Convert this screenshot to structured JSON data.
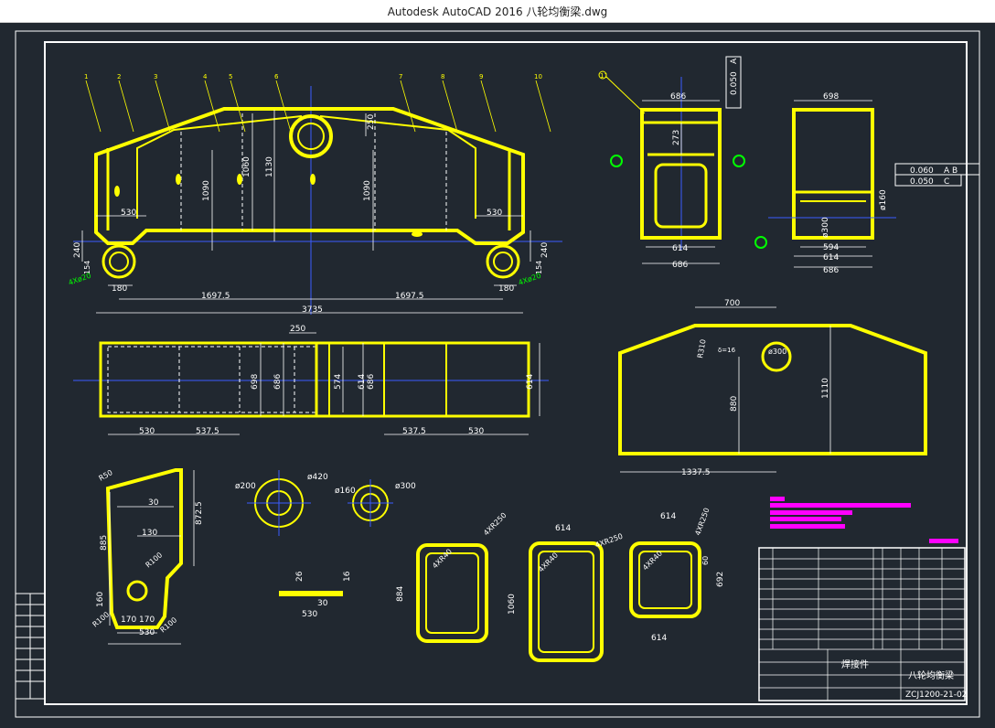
{
  "window": {
    "title": "Autodesk AutoCAD 2016    八轮均衡梁.dwg"
  },
  "colors": {
    "background": "#212830",
    "outline": "#ffff00",
    "dimension": "#ffffff",
    "center": "#3a5bff",
    "leader": "#00ff00",
    "magenta": "#ff00ff"
  },
  "front_view": {
    "dims": {
      "d530_left": "530",
      "d530_right": "530",
      "d1090_a": "1090",
      "d1090_b": "1090",
      "d1060": "1060",
      "d1130": "1130",
      "d250": "250",
      "d240_left": "240",
      "d240_right": "240",
      "d180_left": "180",
      "d180_right": "180",
      "d1697_left": "1697.5",
      "d1697_right": "1697.5",
      "d3735": "3735",
      "hole_left": "4Xø20",
      "hole_right": "4Xø20",
      "d154_left": "154",
      "d154_right": "154"
    },
    "balloons": [
      "1",
      "2",
      "3",
      "4",
      "5",
      "6",
      "7",
      "8",
      "9",
      "10"
    ]
  },
  "top_view": {
    "dims": {
      "d250": "250",
      "d698": "698",
      "d686": "686",
      "d574": "574",
      "d614": "614",
      "d614b": "614",
      "d686b": "686",
      "d530_a": "530",
      "d537_a": "537.5",
      "d537_b": "537.5",
      "d530_b": "530"
    }
  },
  "section_view": {
    "balloon": "11",
    "tol1": "0.050",
    "tol1_ref": "A",
    "dims": {
      "d686_top": "686",
      "d273": "273",
      "d614": "614",
      "d686_bot": "686"
    }
  },
  "side_view": {
    "tol2": "0.060",
    "tol2_ref": "A B",
    "tol3": "0.050",
    "tol3_ref": "C",
    "dims": {
      "d698": "698",
      "d594": "594",
      "d614": "614",
      "d686": "686",
      "d300": "ø300",
      "d160": "ø160"
    }
  },
  "web_plate": {
    "dims": {
      "d700": "700",
      "d1110": "1110",
      "d880": "880",
      "d1337": "1337.5",
      "r310": "R310",
      "hole": "ø300",
      "delta": "δ=16"
    }
  },
  "bracket": {
    "dims": {
      "r50": "R50",
      "d30": "30",
      "d130": "130",
      "r100": "R100",
      "d885": "885",
      "d872": "872.5",
      "d160": "160",
      "d170a": "170",
      "d170b": "170",
      "d530": "530",
      "r100b": "R100",
      "r100c": "R100"
    }
  },
  "rings": {
    "r1_outer": "ø420",
    "r1_inner": "ø200",
    "r2_outer": "ø300",
    "r2_inner": "ø160"
  },
  "strip": {
    "d26": "26",
    "d16": "16",
    "d30": "30",
    "d530": "530"
  },
  "frames": {
    "f1": {
      "r": "4XR250",
      "r2": "4XR40",
      "h": "884"
    },
    "f2": {
      "w": "614",
      "r": "4XR250",
      "r2": "4XR40",
      "h": "1060"
    },
    "f3": {
      "w": "614",
      "r": "4XR250",
      "r2": "4XR40",
      "h": "692",
      "d60": "60"
    }
  },
  "title_block": {
    "part_name": "八轮均衡梁",
    "drawing_no": "ZCJ1200-21-02",
    "material": "焊接件"
  }
}
